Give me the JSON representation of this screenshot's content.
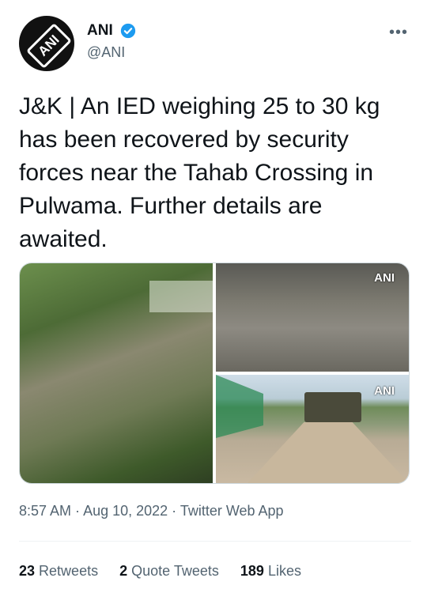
{
  "author": {
    "display_name": "ANI",
    "handle": "@ANI",
    "avatar_text": "ANI",
    "verified_color": "#1d9bf0"
  },
  "more_icon": "•••",
  "tweet": {
    "text": "J&K | An IED weighing 25 to 30 kg has been recovered by security forces near the Tahab Crossing in Pulwama. Further details are awaited."
  },
  "media": {
    "watermark_1": "ANI",
    "watermark_2": "ANI"
  },
  "meta": {
    "time": "8:57 AM",
    "sep1": " · ",
    "date": "Aug 10, 2022",
    "sep2": " · ",
    "source": "Twitter Web App"
  },
  "stats": {
    "retweets_count": "23",
    "retweets_label": "Retweets",
    "quotes_count": "2",
    "quotes_label": "Quote Tweets",
    "likes_count": "189",
    "likes_label": "Likes"
  }
}
